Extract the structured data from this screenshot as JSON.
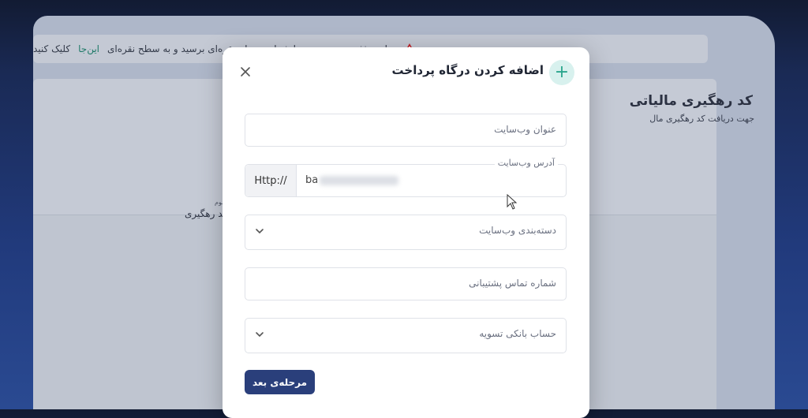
{
  "alert": {
    "text": "برای حذف محدودیت ... تا شما به سطح نقره‌ای برسید و به سطح نقره‌ای ",
    "link_text": "این‌جا",
    "suffix": "کلیک کنید"
  },
  "page": {
    "title": "کد رهگیری مالیاتی",
    "subtitle": "جهت دریافت کد رهگیری مال",
    "step_label": "مرحله‌ی سوم",
    "step_text": "دریافت کد رهگیری"
  },
  "modal": {
    "title": "اضافه کردن درگاه پرداخت",
    "website_title_placeholder": "عنوان وب‌سایت",
    "address_label": "آدرس وب‌سایت",
    "address_prefix": "Http://",
    "address_value": "ba",
    "category_placeholder": "دسته‌بندی وب‌سایت",
    "support_phone_placeholder": "شماره تماس پشتیبانی",
    "bank_account_placeholder": "حساب بانکی تسویه",
    "next_button": "مرحله‌ی بعد"
  },
  "colors": {
    "primary": "#2a3f7b",
    "accent": "#2aa58d",
    "warning": "#c0262d"
  }
}
